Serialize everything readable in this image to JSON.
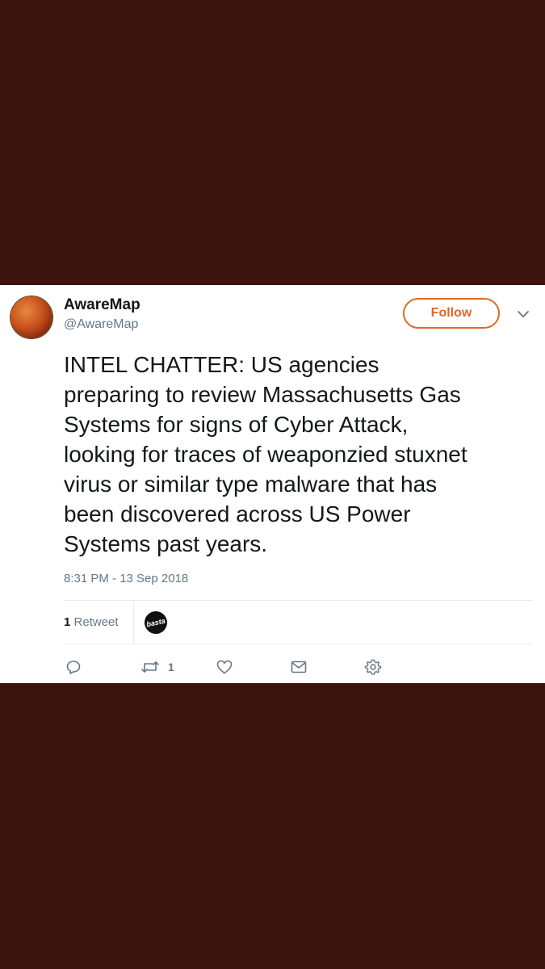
{
  "tweet": {
    "display_name": "AwareMap",
    "handle": "@AwareMap",
    "follow_label": "Follow",
    "text": "INTEL CHATTER: US agencies\npreparing to review Massachusetts Gas\nSystems for signs of Cyber Attack,\nlooking for traces of weaponzied stuxnet\nvirus or similar type malware that has\nbeen discovered across US Power\nSystems past years.",
    "timestamp": "8:31 PM - 13 Sep 2018",
    "stats": {
      "retweet_count": "1",
      "retweet_label": "Retweet",
      "retweeter_avatar_text": "basta"
    },
    "actions": {
      "reply_icon": "reply-icon",
      "retweet_icon": "retweet-icon",
      "retweet_count": "1",
      "like_icon": "heart-icon",
      "message_icon": "envelope-icon",
      "more_icon": "gear-icon"
    }
  },
  "colors": {
    "background": "#3b140d",
    "accent": "#e0682a",
    "text_primary": "#14171a",
    "text_secondary": "#657786"
  }
}
